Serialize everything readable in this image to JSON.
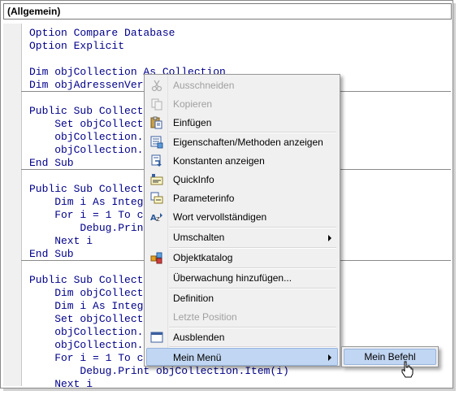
{
  "header": {
    "procedure_combo": "(Allgemein)"
  },
  "code_lines": [
    "Option Compare Database",
    "Option Explicit",
    "",
    "Dim objCollection As Collection",
    "Dim objAdressenVer",
    "",
    "Public Sub Collect",
    "    Set objCollect",
    "    objCollection.",
    "    objCollection.",
    "End Sub",
    "",
    "Public Sub Collect",
    "    Dim i As Integ",
    "    For i = 1 To c",
    "        Debug.Prin",
    "    Next i",
    "End Sub",
    "",
    "Public Sub Collect",
    "    Dim objCollect",
    "    Dim i As Integ",
    "    Set objCollect",
    "    objCollection.",
    "    objCollection.",
    "    For i = 1 To c",
    "        Debug.Print objCollection.Item(i)",
    "    Next i"
  ],
  "context_menu": {
    "items": [
      {
        "label": "Ausschneiden",
        "icon": "cut-icon",
        "disabled": true
      },
      {
        "label": "Kopieren",
        "icon": "copy-icon",
        "disabled": true
      },
      {
        "label": "Einfügen",
        "icon": "paste-icon",
        "disabled": false
      },
      {
        "label": "Eigenschaften/Methoden anzeigen",
        "icon": "list-members-icon",
        "disabled": false
      },
      {
        "label": "Konstanten anzeigen",
        "icon": "list-constants-icon",
        "disabled": false
      },
      {
        "label": "QuickInfo",
        "icon": "quick-info-icon",
        "disabled": false
      },
      {
        "label": "Parameterinfo",
        "icon": "parameter-info-icon",
        "disabled": false
      },
      {
        "label": "Wort vervollständigen",
        "icon": "complete-word-icon",
        "disabled": false
      },
      {
        "label": "Umschalten",
        "icon": "",
        "disabled": false,
        "submenu": true
      },
      {
        "label": "Objektkatalog",
        "icon": "object-browser-icon",
        "disabled": false
      },
      {
        "label": "Überwachung hinzufügen...",
        "icon": "",
        "disabled": false
      },
      {
        "label": "Definition",
        "icon": "",
        "disabled": false
      },
      {
        "label": "Letzte Position",
        "icon": "",
        "disabled": true
      },
      {
        "label": "Ausblenden",
        "icon": "hide-window-icon",
        "disabled": false
      },
      {
        "label": "Mein Menü",
        "icon": "",
        "disabled": false,
        "submenu": true,
        "highlighted": true
      }
    ]
  },
  "submenu": {
    "item": "Mein Befehl"
  },
  "colors": {
    "code_text": "#00008b",
    "highlight": "#c1d6f2",
    "highlight_border": "#98b4dd",
    "menu_bg": "#f0f0f0"
  }
}
